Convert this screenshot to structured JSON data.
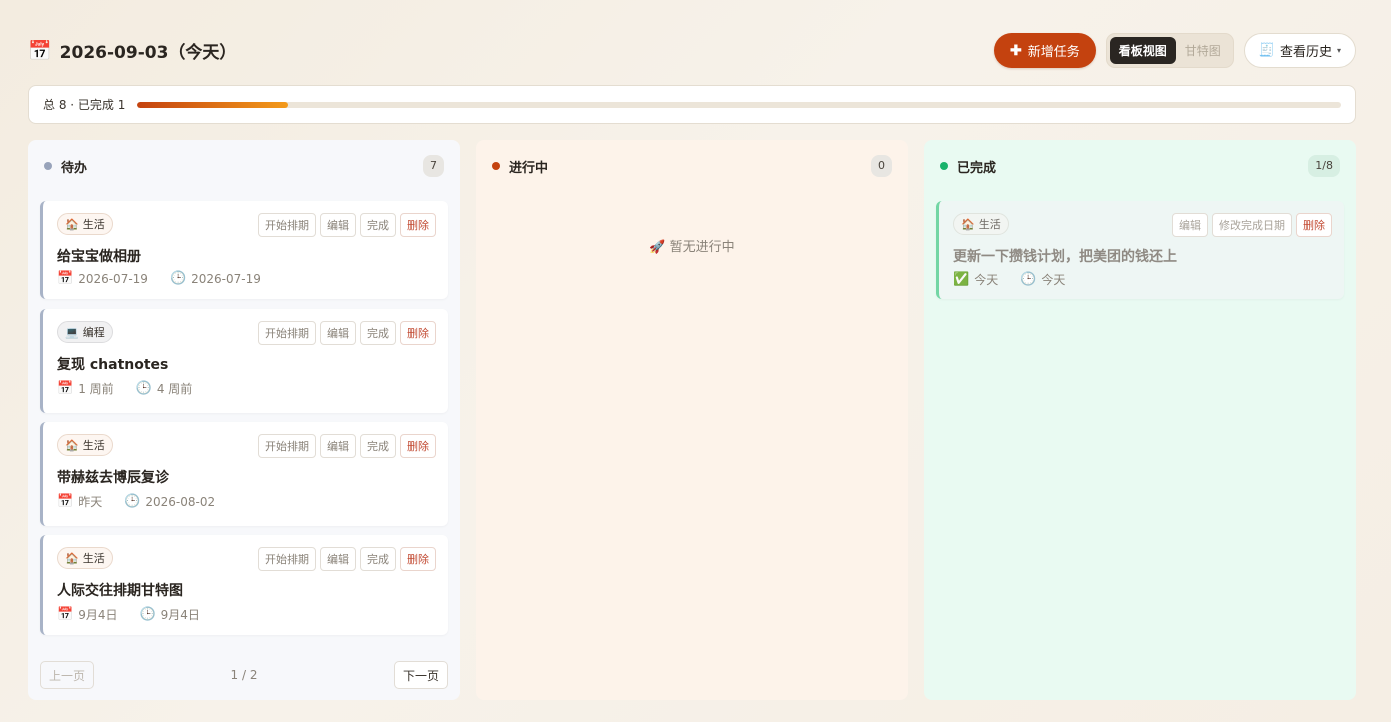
{
  "header": {
    "calendar_icon": "📅",
    "date_title": "2026-09-03（今天）",
    "new_task_icon": "➕",
    "new_task_label": "新增任务",
    "view_kanban": "看板视图",
    "view_gantt": "甘特图",
    "history_icon": "🧾",
    "history_label": "查看历史",
    "history_caret": "▾"
  },
  "progress": {
    "text": "总 8 · 已完成 1",
    "completed": 1,
    "total": 8
  },
  "colors": {
    "accent": "#c4420f",
    "todo_dot": "#98a3ba",
    "doing_dot": "#c4420f",
    "done_dot": "#18b26b"
  },
  "columns": {
    "todo": {
      "title": "待办",
      "count": "7",
      "cards": [
        {
          "tag_icon": "🏠",
          "tag": "生活",
          "title": "给宝宝做相册",
          "meta1_icon": "📅",
          "meta1": "2026-07-19",
          "meta2_icon": "🕒",
          "meta2": "2026-07-19"
        },
        {
          "tag_icon": "💻",
          "tag": "编程",
          "title": "复现 chatnotes",
          "meta1_icon": "📅",
          "meta1": "1 周前",
          "meta2_icon": "🕒",
          "meta2": "4 周前"
        },
        {
          "tag_icon": "🏠",
          "tag": "生活",
          "title": "带赫兹去博辰复诊",
          "meta1_icon": "📅",
          "meta1": "昨天",
          "meta2_icon": "🕒",
          "meta2": "2026-08-02"
        },
        {
          "tag_icon": "🏠",
          "tag": "生活",
          "title": "人际交往排期甘特图",
          "meta1_icon": "📅",
          "meta1": "9月4日",
          "meta2_icon": "🕒",
          "meta2": "9月4日"
        }
      ],
      "actions": {
        "start": "开始排期",
        "edit": "编辑",
        "complete": "完成",
        "delete": "删除"
      },
      "pager": {
        "prev": "上一页",
        "info": "1 / 2",
        "next": "下一页"
      }
    },
    "doing": {
      "title": "进行中",
      "count": "0",
      "empty_text": "🚀 暂无进行中"
    },
    "done": {
      "title": "已完成",
      "count": "1/8",
      "cards": [
        {
          "tag_icon": "🏠",
          "tag": "生活",
          "title": "更新一下攒钱计划，把美团的钱还上",
          "meta1_icon": "✅",
          "meta1": "今天",
          "meta2_icon": "🕒",
          "meta2": "今天"
        }
      ],
      "actions": {
        "edit": "编辑",
        "change_date": "修改完成日期",
        "delete": "删除"
      }
    }
  }
}
